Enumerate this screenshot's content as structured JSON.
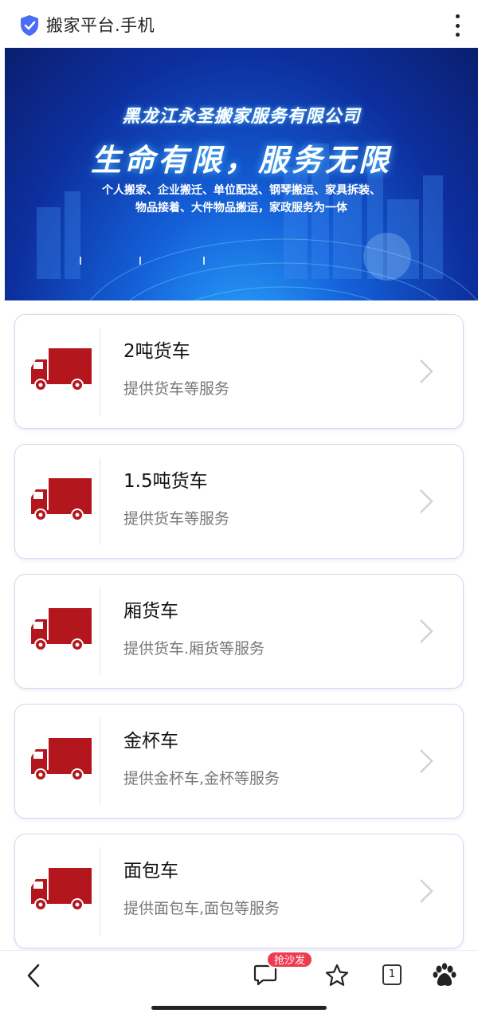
{
  "header": {
    "title": "搬家平台.手机"
  },
  "banner": {
    "company": "黑龙江永圣搬家服务有限公司",
    "slogan": "生命有限，服务无限",
    "line1": "个人搬家、企业搬迁、单位配送、钢琴搬运、家具拆装、",
    "line2": "物品接着、大件物品搬运，家政服务为一体"
  },
  "services": [
    {
      "name": "2吨货车",
      "desc": "提供货车等服务"
    },
    {
      "name": "1.5吨货车",
      "desc": "提供货车等服务"
    },
    {
      "name": "厢货车",
      "desc": "提供货车.厢货等服务"
    },
    {
      "name": "金杯车",
      "desc": "提供金杯车,金杯等服务"
    },
    {
      "name": "面包车",
      "desc": "提供面包车,面包等服务"
    }
  ],
  "bottom_nav": {
    "badge": "抢沙发",
    "tab_count": "1"
  },
  "colors": {
    "truck": "#b3161c",
    "badge": "#ef3b4f",
    "shield": "#4a6cf7"
  }
}
